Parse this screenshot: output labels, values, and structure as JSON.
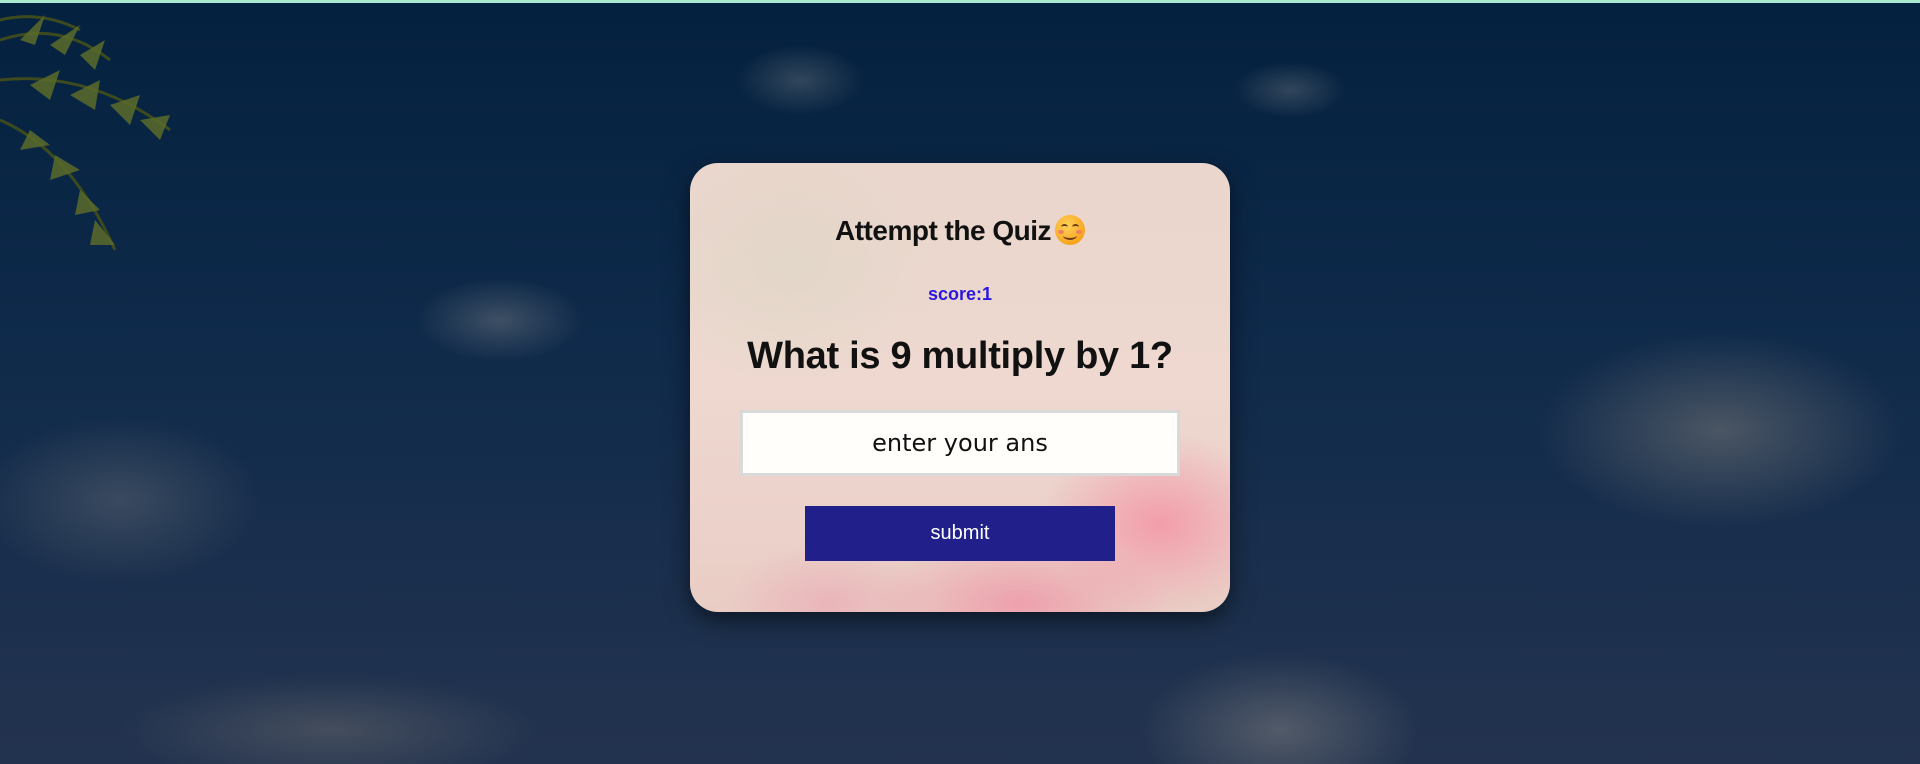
{
  "quiz": {
    "title": "Attempt the Quiz",
    "title_icon": "smiling-face-icon",
    "score_label": "score:1",
    "question": "What is 9 multiply by 1?",
    "answer_placeholder": "enter your ans",
    "answer_value": "",
    "submit_label": "submit"
  },
  "colors": {
    "accent_button": "#21208a",
    "score_text": "#2b17e0"
  }
}
